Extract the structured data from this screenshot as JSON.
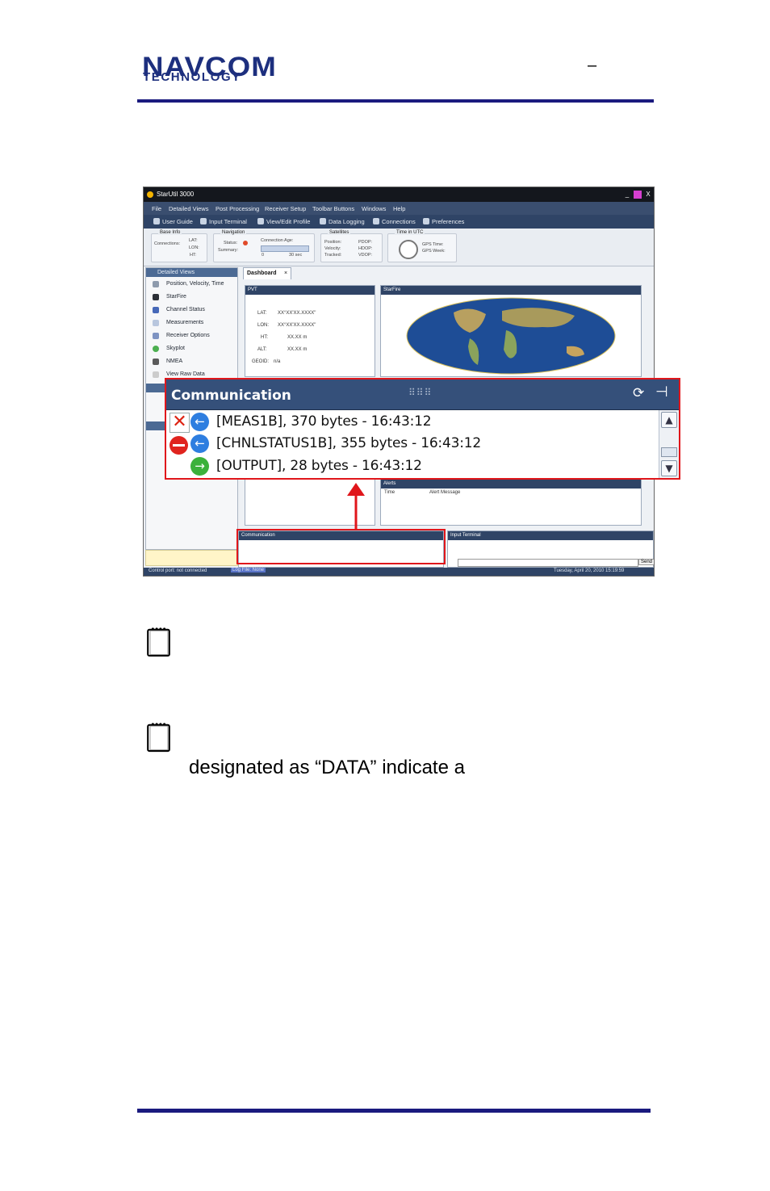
{
  "header": {
    "logo_main": "NAVCOM",
    "logo_sub": "TECHNOLOGY",
    "title_dash": "–"
  },
  "screenshot": {
    "window_title": "StarUtil 3000",
    "window_buttons": [
      "_",
      "□",
      "X"
    ],
    "menu": [
      "File",
      "Detailed Views",
      "Post Processing",
      "Receiver Setup",
      "Toolbar Buttons",
      "Windows",
      "Help"
    ],
    "toolbar": [
      "User Guide",
      "Input Terminal",
      "View/Edit Profile",
      "Data Logging",
      "Connections",
      "Preferences"
    ],
    "status_groups": {
      "base_info": {
        "title": "Base Info",
        "connections": "Connections:",
        "lat": "LAT:",
        "lon": "LON:",
        "ht": "HT:"
      },
      "navigation": {
        "title": "Navigation",
        "status": "Status:",
        "summary": "Summary:",
        "conn_age": "Connection Age:",
        "scale_min": "0",
        "scale_max": "30 sec"
      },
      "satellites": {
        "title": "Satellites",
        "position": "Position:",
        "velocity": "Velocity:",
        "tracked": "Tracked:",
        "pdop": "PDOP:",
        "hdop": "HDOP:",
        "vdop": "VDOP:"
      },
      "time": {
        "title": "Time in UTC",
        "gps_time": "GPS Time:",
        "gps_week": "GPS Week:"
      }
    },
    "sidebar": {
      "section_detailed": "Detailed Views",
      "items": [
        "Position, Velocity, Time",
        "StarFire",
        "Channel Status",
        "Measurements",
        "Receiver Options",
        "Skyplot",
        "NMEA",
        "View Raw Data"
      ]
    },
    "dashboard": {
      "tab": "Dashboard",
      "tab_close": "×",
      "pvt": {
        "title": "PVT",
        "lat_label": "LAT:",
        "lat_value": "XX°XX'XX.XXXX\"",
        "lon_label": "LON:",
        "lon_value": "XX°XX'XX.XXXX\"",
        "ht_label": "HT:",
        "ht_value": "XX.XX m",
        "alt_label": "ALT:",
        "alt_value": "XX.XX m",
        "geoid_label": "GEOID:",
        "geoid_value": "n/a"
      },
      "starfire": {
        "title": "StarFire"
      },
      "alerts": {
        "title": "Alerts",
        "col_time": "Time",
        "col_message": "Alert Message"
      }
    },
    "bottom_panels": {
      "communication": "Communication",
      "input_terminal": "Input Terminal",
      "send": "Send"
    },
    "statusbar": {
      "control_port": "Control port: not connected",
      "log_file": "Log File: None",
      "datetime": "Tuesday, April 20, 2010 15:19:59"
    }
  },
  "callout": {
    "title": "Communication",
    "lines": [
      "[MEAS1B], 370 bytes - 16:43:12",
      "[CHNLSTATUS1B], 355 bytes - 16:43:12",
      "[OUTPUT], 28 bytes - 16:43:12"
    ]
  },
  "note_text": "designated as “DATA” indicate a",
  "colors": {
    "brand_blue": "#1d2f7e",
    "rule_blue": "#1a1a7e",
    "callout_red": "#e0161b"
  }
}
